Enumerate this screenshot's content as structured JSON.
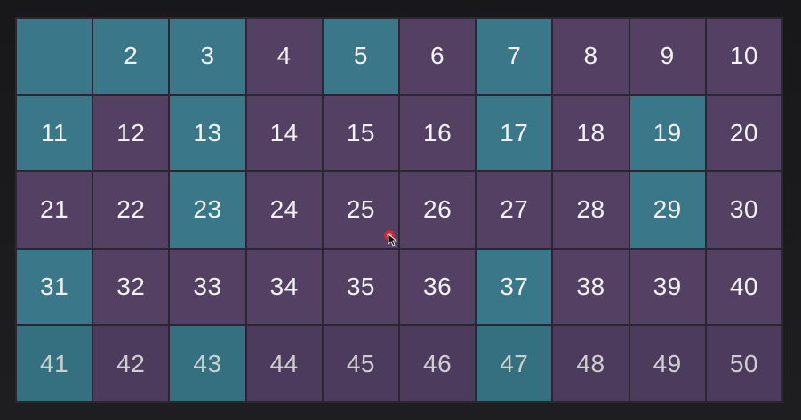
{
  "grid": {
    "cells": [
      {
        "n": "",
        "kind": "empty"
      },
      {
        "n": "2",
        "kind": "prime"
      },
      {
        "n": "3",
        "kind": "prime"
      },
      {
        "n": "4",
        "kind": "composite"
      },
      {
        "n": "5",
        "kind": "prime"
      },
      {
        "n": "6",
        "kind": "composite"
      },
      {
        "n": "7",
        "kind": "prime"
      },
      {
        "n": "8",
        "kind": "composite"
      },
      {
        "n": "9",
        "kind": "composite"
      },
      {
        "n": "10",
        "kind": "composite"
      },
      {
        "n": "11",
        "kind": "prime"
      },
      {
        "n": "12",
        "kind": "composite"
      },
      {
        "n": "13",
        "kind": "prime"
      },
      {
        "n": "14",
        "kind": "composite"
      },
      {
        "n": "15",
        "kind": "composite"
      },
      {
        "n": "16",
        "kind": "composite"
      },
      {
        "n": "17",
        "kind": "prime"
      },
      {
        "n": "18",
        "kind": "composite"
      },
      {
        "n": "19",
        "kind": "prime"
      },
      {
        "n": "20",
        "kind": "composite"
      },
      {
        "n": "21",
        "kind": "composite"
      },
      {
        "n": "22",
        "kind": "composite"
      },
      {
        "n": "23",
        "kind": "prime"
      },
      {
        "n": "24",
        "kind": "composite"
      },
      {
        "n": "25",
        "kind": "composite"
      },
      {
        "n": "26",
        "kind": "composite"
      },
      {
        "n": "27",
        "kind": "composite"
      },
      {
        "n": "28",
        "kind": "composite"
      },
      {
        "n": "29",
        "kind": "prime"
      },
      {
        "n": "30",
        "kind": "composite"
      },
      {
        "n": "31",
        "kind": "prime"
      },
      {
        "n": "32",
        "kind": "composite"
      },
      {
        "n": "33",
        "kind": "composite"
      },
      {
        "n": "34",
        "kind": "composite"
      },
      {
        "n": "35",
        "kind": "composite"
      },
      {
        "n": "36",
        "kind": "composite"
      },
      {
        "n": "37",
        "kind": "prime"
      },
      {
        "n": "38",
        "kind": "composite"
      },
      {
        "n": "39",
        "kind": "composite"
      },
      {
        "n": "40",
        "kind": "composite"
      },
      {
        "n": "41",
        "kind": "prime",
        "dim": true
      },
      {
        "n": "42",
        "kind": "composite",
        "dim": true
      },
      {
        "n": "43",
        "kind": "prime",
        "dim": true
      },
      {
        "n": "44",
        "kind": "composite",
        "dim": true
      },
      {
        "n": "45",
        "kind": "composite",
        "dim": true
      },
      {
        "n": "46",
        "kind": "composite",
        "dim": true
      },
      {
        "n": "47",
        "kind": "prime",
        "dim": true
      },
      {
        "n": "48",
        "kind": "composite",
        "dim": true
      },
      {
        "n": "49",
        "kind": "composite",
        "dim": true
      },
      {
        "n": "50",
        "kind": "composite",
        "dim": true
      }
    ]
  },
  "colors": {
    "prime": "#3a7788",
    "composite": "#534063",
    "background": "#1a1a1c"
  },
  "cursor": {
    "icon": "mouse-pointer-icon",
    "highlight_color": "#e0262b"
  }
}
